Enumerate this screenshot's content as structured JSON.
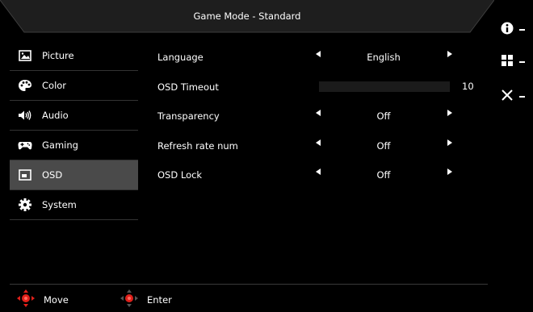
{
  "header": {
    "title": "Game Mode - Standard"
  },
  "sidebar": {
    "items": [
      {
        "label": "Picture",
        "icon": "picture-icon",
        "active": false
      },
      {
        "label": "Color",
        "icon": "palette-icon",
        "active": false
      },
      {
        "label": "Audio",
        "icon": "speaker-icon",
        "active": false
      },
      {
        "label": "Gaming",
        "icon": "gamepad-icon",
        "active": false
      },
      {
        "label": "OSD",
        "icon": "osd-window-icon",
        "active": true
      },
      {
        "label": "System",
        "icon": "gear-icon",
        "active": false
      }
    ]
  },
  "settings": {
    "language": {
      "label": "Language",
      "value": "English"
    },
    "osd_timeout": {
      "label": "OSD Timeout",
      "value": "10"
    },
    "transparency": {
      "label": "Transparency",
      "value": "Off"
    },
    "refresh_rate_num": {
      "label": "Refresh rate num",
      "value": "Off"
    },
    "osd_lock": {
      "label": "OSD Lock",
      "value": "Off"
    }
  },
  "footer": {
    "move_label": "Move",
    "enter_label": "Enter"
  },
  "right_panel": {
    "buttons": [
      "info-icon",
      "menu-grid-icon",
      "close-icon"
    ]
  },
  "colors": {
    "background": "#000000",
    "header_bar": "#1e1e1e",
    "active_item": "#4a4a4a",
    "accent_red": "#e0201a"
  }
}
